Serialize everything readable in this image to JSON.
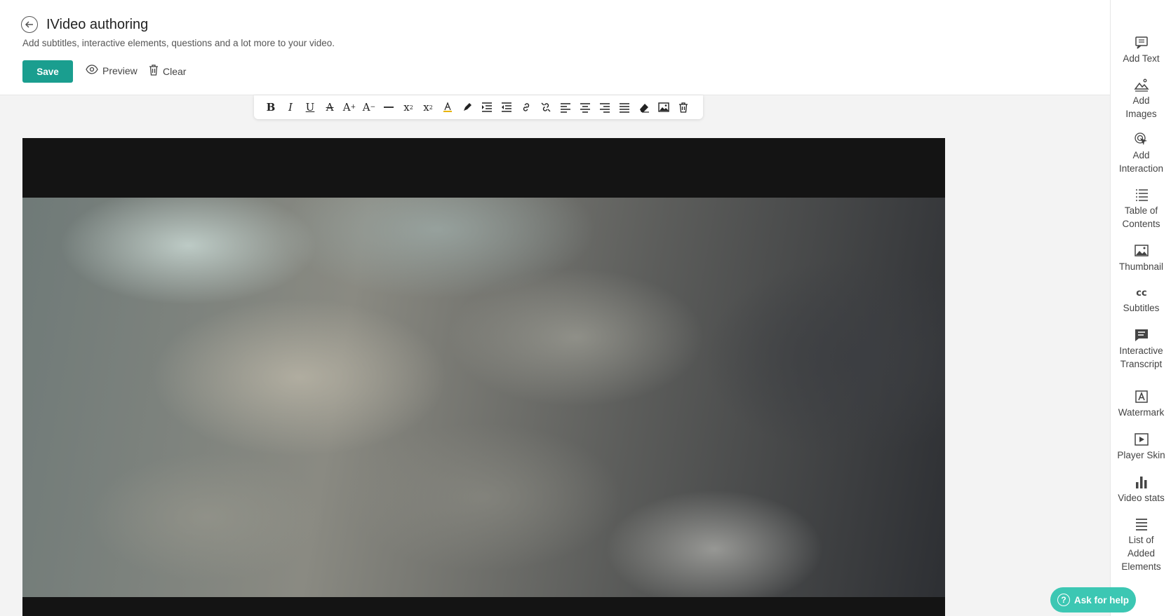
{
  "header": {
    "title": "IVideo authoring",
    "subtitle": "Add subtitles, interactive elements, questions and a lot more to your video.",
    "save_label": "Save",
    "preview_label": "Preview",
    "clear_label": "Clear"
  },
  "toolbar": {
    "bold": "B",
    "italic": "I",
    "underline": "U",
    "strike": "A",
    "font_up": "A",
    "font_down": "A",
    "subscript": "x",
    "superscript": "x"
  },
  "sidebar": {
    "items": [
      {
        "label": "Add Text",
        "icon": "comment-icon"
      },
      {
        "label": "Add\nImages",
        "icon": "image-mountain-icon"
      },
      {
        "label": "Add\nInteraction",
        "icon": "pointer-click-icon"
      },
      {
        "label": "Table of\nContents",
        "icon": "list-icon"
      },
      {
        "label": "Thumbnail",
        "icon": "picture-icon"
      },
      {
        "label": "Subtitles",
        "icon": "cc-icon"
      },
      {
        "label": "Interactive\nTranscript",
        "icon": "chat-icon"
      },
      {
        "label": "Watermark",
        "icon": "watermark-icon"
      },
      {
        "label": "Player Skin",
        "icon": "play-box-icon"
      },
      {
        "label": "Video stats",
        "icon": "bar-chart-icon"
      },
      {
        "label": "List of\nAdded\nElements",
        "icon": "lines-icon"
      }
    ]
  },
  "help": {
    "label": "Ask for help",
    "q": "?"
  },
  "colors": {
    "accent": "#1a9e8f",
    "help": "#3cc7b3"
  }
}
